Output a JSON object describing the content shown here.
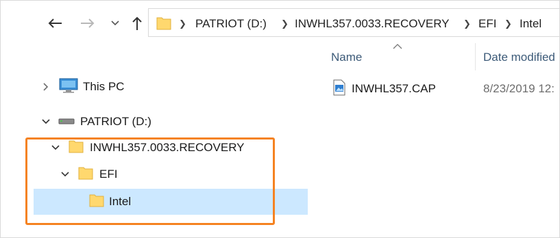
{
  "address_bar": {
    "crumbs": [
      "PATRIOT (D:)",
      "INWHL357.0033.RECOVERY",
      "EFI",
      "Intel"
    ]
  },
  "nav_pane": {
    "items": [
      {
        "label": "This PC",
        "icon": "monitor-icon",
        "expanded": false
      },
      {
        "label": "PATRIOT (D:)",
        "icon": "drive-icon",
        "expanded": true
      },
      {
        "label": "INWHL357.0033.RECOVERY",
        "icon": "folder-icon",
        "expanded": true
      },
      {
        "label": "EFI",
        "icon": "folder-icon",
        "expanded": true
      },
      {
        "label": "Intel",
        "icon": "folder-icon",
        "selected": true
      }
    ]
  },
  "file_list": {
    "columns": [
      "Name",
      "Date modified"
    ],
    "files": [
      {
        "name": "INWHL357.CAP",
        "date_modified": "8/23/2019 12:"
      }
    ]
  },
  "colors": {
    "selection": "#cce8ff",
    "highlight_border": "#f58220",
    "folder": "#ffd86e"
  }
}
